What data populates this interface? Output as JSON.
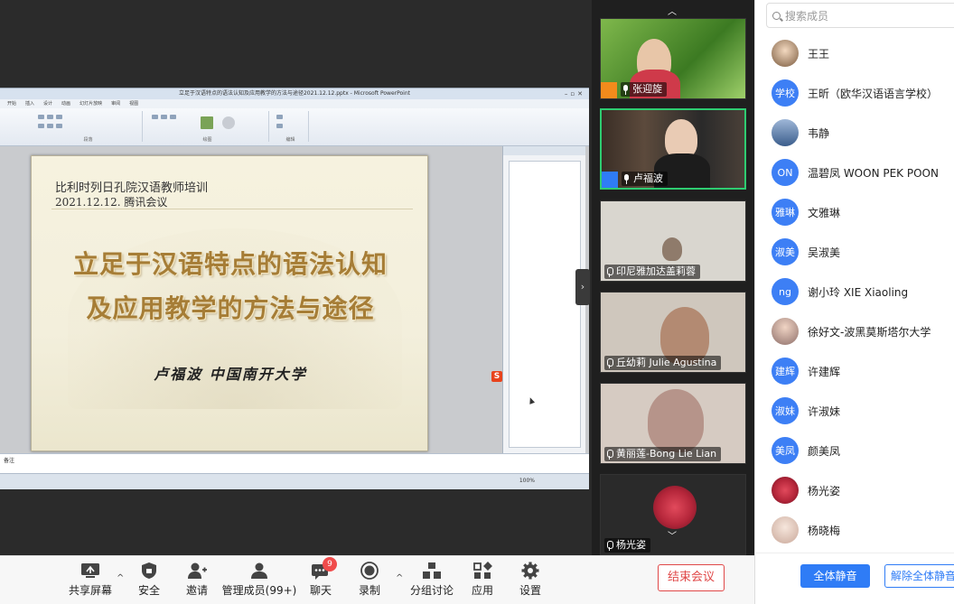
{
  "ppt": {
    "window_title": "立足于汉语特点的语法认知及应用教学的方法与途径2021.12.12.pptx - Microsoft PowerPoint",
    "ribbon_tabs": [
      "开始",
      "插入",
      "设计",
      "动画",
      "幻灯片放映",
      "审阅",
      "视图"
    ],
    "group_labels": [
      "段落",
      "绘图",
      "编辑"
    ],
    "notes_label": "备注",
    "zoom": "100%",
    "ime_glyph": "S"
  },
  "slide": {
    "subtitle_line1": "比利时列日孔院汉语教师培训",
    "subtitle_line2": "2021.12.12.  腾讯会议",
    "title_line1": "立足于汉语特点的语法认知",
    "title_line2": "及应用教学的方法与途径",
    "author": "卢福波  中国南开大学"
  },
  "gallery": {
    "tiles": [
      {
        "name": "张迎旋"
      },
      {
        "name": "卢福波"
      },
      {
        "name": "印尼雅加达盖莉蓉"
      },
      {
        "name": "丘幼莉 Julie Agustina"
      },
      {
        "name": "黄丽莲-Bong Lie Lian"
      },
      {
        "name": "杨光姿"
      }
    ],
    "up_glyph": "︿",
    "down_glyph": "﹀",
    "collapse_glyph": "›"
  },
  "panel": {
    "search_placeholder": "搜索成员",
    "members": [
      {
        "name": "王王",
        "avatar": ""
      },
      {
        "name": "王昕（欧华汉语语言学校）",
        "avatar": "学校"
      },
      {
        "name": "韦静",
        "avatar": ""
      },
      {
        "name": "温碧凤 WOON PEK POON",
        "avatar": "ON"
      },
      {
        "name": "文雅琳",
        "avatar": "雅琳"
      },
      {
        "name": "吴淑美",
        "avatar": "淑美"
      },
      {
        "name": "谢小玲 XIE Xiaoling",
        "avatar": "ng"
      },
      {
        "name": "徐好文-波黑莫斯塔尔大学",
        "avatar": ""
      },
      {
        "name": "许建辉",
        "avatar": "建辉"
      },
      {
        "name": "许淑妹",
        "avatar": "淑妹"
      },
      {
        "name": "颜美凤",
        "avatar": "美凤"
      },
      {
        "name": "杨光姿",
        "avatar": ""
      },
      {
        "name": "杨晓梅",
        "avatar": ""
      }
    ],
    "mute_all": "全体静音",
    "unmute_all": "解除全体静音"
  },
  "toolbar": {
    "share_screen": "共享屏幕",
    "security": "安全",
    "invite": "邀请",
    "manage_members": "管理成员(99+)",
    "chat": "聊天",
    "chat_badge": "9",
    "record": "录制",
    "breakout": "分组讨论",
    "apps": "应用",
    "settings": "设置",
    "end_meeting": "结束会议",
    "caret": "^"
  },
  "colors": {
    "accent": "#2f7cf6",
    "danger": "#e04848",
    "slide_title": "#a67d36",
    "active_speaker": "#2ecc71"
  }
}
